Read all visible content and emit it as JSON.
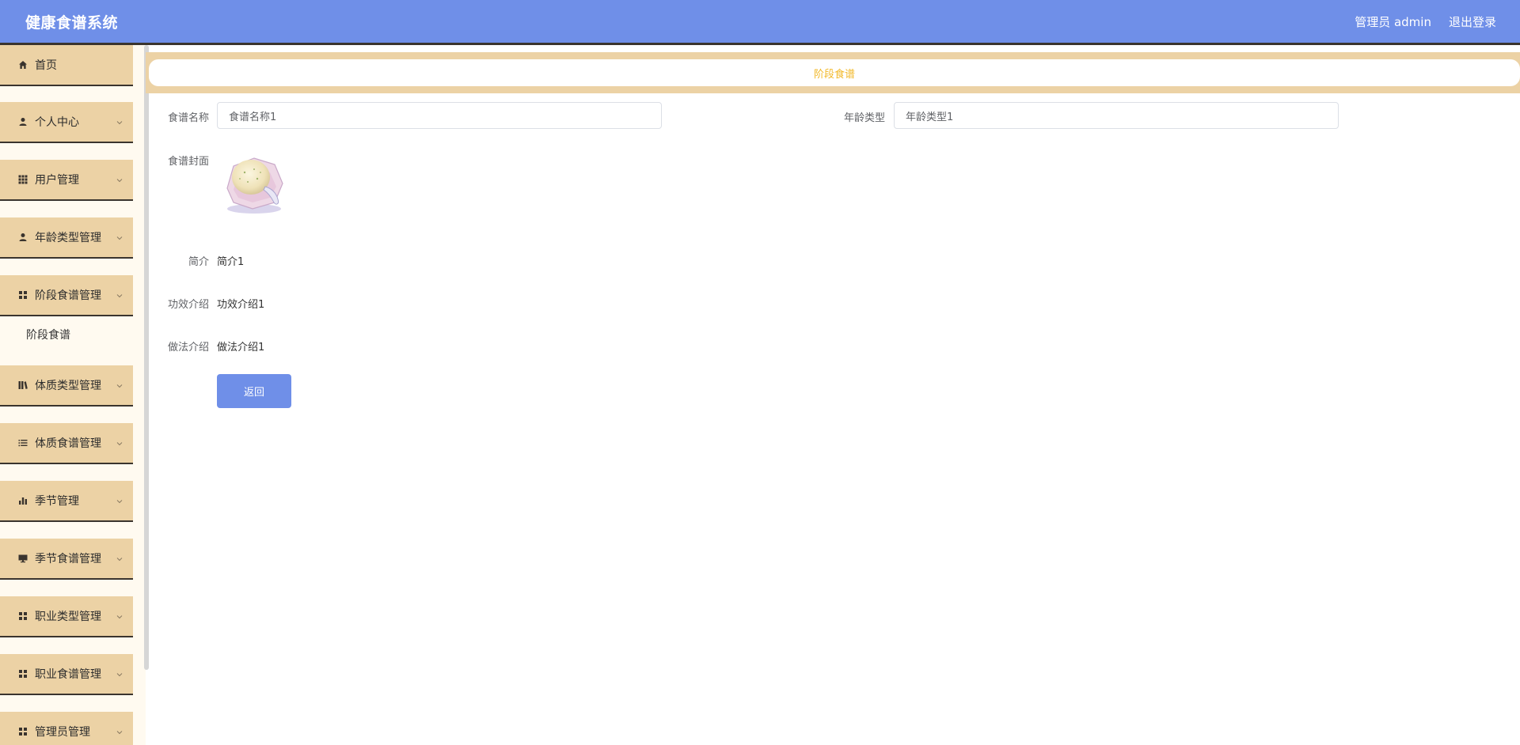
{
  "header": {
    "title": "健康食谱系统",
    "user_label": "管理员 admin",
    "logout_label": "退出登录"
  },
  "sidebar": {
    "items": [
      {
        "label": "首页",
        "icon": "home-icon"
      },
      {
        "label": "个人中心",
        "icon": "user-icon"
      },
      {
        "label": "用户管理",
        "icon": "grid-icon"
      },
      {
        "label": "年龄类型管理",
        "icon": "user-icon"
      },
      {
        "label": "阶段食谱管理",
        "icon": "apps-icon"
      },
      {
        "label": "体质类型管理",
        "icon": "books-icon"
      },
      {
        "label": "体质食谱管理",
        "icon": "list-icon"
      },
      {
        "label": "季节管理",
        "icon": "bar-chart-icon"
      },
      {
        "label": "季节食谱管理",
        "icon": "monitor-icon"
      },
      {
        "label": "职业类型管理",
        "icon": "apps-icon"
      },
      {
        "label": "职业食谱管理",
        "icon": "apps-icon"
      },
      {
        "label": "管理员管理",
        "icon": "apps-icon"
      }
    ],
    "submenu": {
      "label": "阶段食谱"
    }
  },
  "breadcrumb": {
    "current": "阶段食谱"
  },
  "form": {
    "recipe_name_label": "食谱名称",
    "recipe_name_value": "食谱名称1",
    "age_type_label": "年龄类型",
    "age_type_value": "年龄类型1",
    "cover_label": "食谱封面",
    "intro_label": "简介",
    "intro_value": "简介1",
    "effect_label": "功效介绍",
    "effect_value": "功效介绍1",
    "method_label": "做法介绍",
    "method_value": "做法介绍1",
    "back_label": "返回"
  },
  "colors": {
    "header_bg": "#6f8fe8",
    "menu_bg": "#ecd2a5",
    "crumb_text": "#f2b92a"
  }
}
